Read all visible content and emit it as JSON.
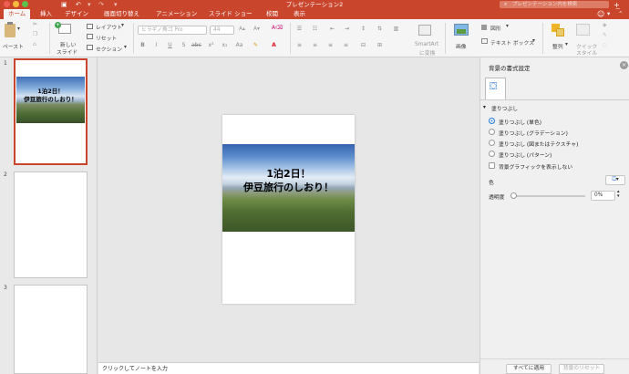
{
  "window": {
    "title": "プレゼンテーション2"
  },
  "search": {
    "placeholder": "プレゼンテーション内を検索"
  },
  "tabs": [
    {
      "label": "ホーム",
      "active": true
    },
    {
      "label": "挿入"
    },
    {
      "label": "デザイン"
    },
    {
      "label": "画面切り替え"
    },
    {
      "label": "アニメーション"
    },
    {
      "label": "スライド ショー"
    },
    {
      "label": "校閲"
    },
    {
      "label": "表示"
    }
  ],
  "ribbon": {
    "paste": "ペースト",
    "new_slide_1": "新しい",
    "new_slide_2": "スライド",
    "layout": "レイアウト",
    "reset": "リセット",
    "section": "セクション",
    "font_name": "ヒラギノ角ゴ Pro",
    "font_size": "44",
    "smartart_1": "SmartArt",
    "smartart_2": "に変換",
    "picture": "画像",
    "shapes": "図形",
    "textbox": "テキスト ボックス",
    "arrange": "整列",
    "quick_1": "クイック",
    "quick_2": "スタイル"
  },
  "thumbs": [
    {
      "num": "1",
      "selected": true
    },
    {
      "num": "2"
    },
    {
      "num": "3"
    }
  ],
  "slide": {
    "line1": "1泊2日！",
    "line2": "伊豆旅行のしおり！"
  },
  "notes": {
    "placeholder": "クリックしてノートを入力"
  },
  "panel": {
    "title": "背景の書式設定",
    "section": "塗りつぶし",
    "options": [
      {
        "label": "塗りつぶし (単色)",
        "selected": true
      },
      {
        "label": "塗りつぶし (グラデーション)"
      },
      {
        "label": "塗りつぶし (図またはテクスチャ)"
      },
      {
        "label": "塗りつぶし (パターン)"
      }
    ],
    "hide_bg": "背景グラフィックを表示しない",
    "color": "色",
    "transparency": "透明度",
    "transparency_value": "0%",
    "apply_all": "すべてに適用",
    "reset_bg": "背景のリセット"
  },
  "colors": {
    "accent": "#c9462c",
    "selected_radio": "#2d7bd6"
  },
  "icons": [
    "traffic-light-close",
    "traffic-light-minimize",
    "traffic-light-zoom",
    "save-icon",
    "undo-icon",
    "redo-icon",
    "search-icon",
    "smiley-icon",
    "paint-bucket-icon",
    "close-icon"
  ]
}
